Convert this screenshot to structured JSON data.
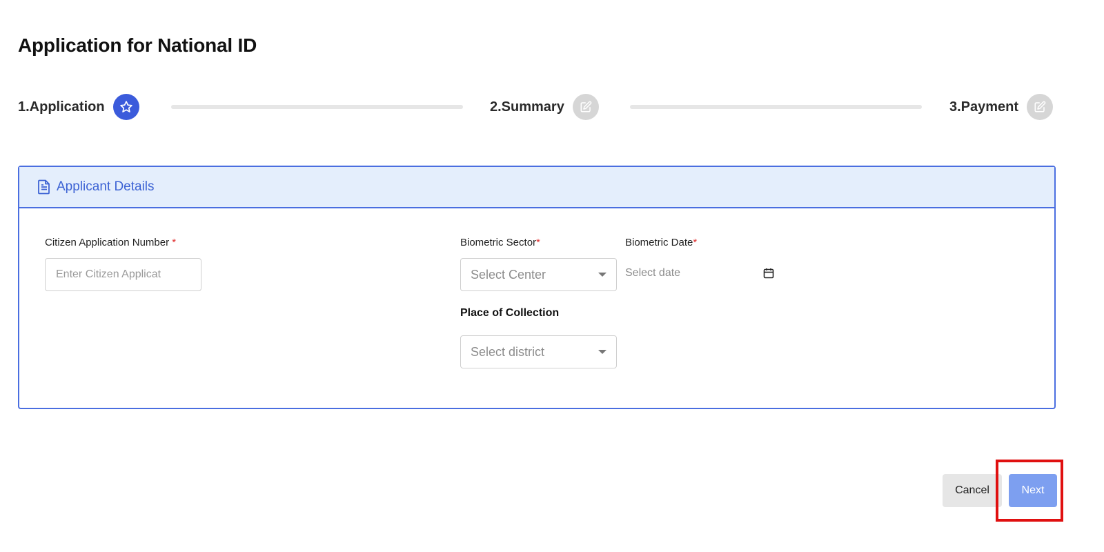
{
  "page": {
    "title": "Application for National ID"
  },
  "stepper": {
    "steps": [
      {
        "label": "1.Application",
        "icon": "star-icon",
        "state": "active"
      },
      {
        "label": "2.Summary",
        "icon": "edit-icon",
        "state": "inactive"
      },
      {
        "label": "3.Payment",
        "icon": "edit-icon",
        "state": "inactive"
      }
    ]
  },
  "card": {
    "title": "Applicant Details",
    "icon": "document-icon",
    "fields": {
      "citizen_application_number": {
        "label": "Citizen Application Number ",
        "required_mark": "*",
        "placeholder": "Enter Citizen Applicat",
        "value": ""
      },
      "biometric_sector": {
        "label": "Biometric Sector",
        "required_mark": "*",
        "selected": "Select Center"
      },
      "biometric_date": {
        "label": "Biometric Date",
        "required_mark": "*",
        "placeholder": "Select date",
        "icon": "calendar-icon"
      },
      "place_of_collection": {
        "label": "Place of Collection",
        "selected": "Select district"
      }
    }
  },
  "actions": {
    "cancel_label": "Cancel",
    "next_label": "Next"
  },
  "colors": {
    "accent": "#3b5bdb",
    "card_border": "#4a6ee0",
    "card_header_bg": "#e4eefc",
    "next_button": "#7d9ff0",
    "highlight": "#e01010"
  }
}
